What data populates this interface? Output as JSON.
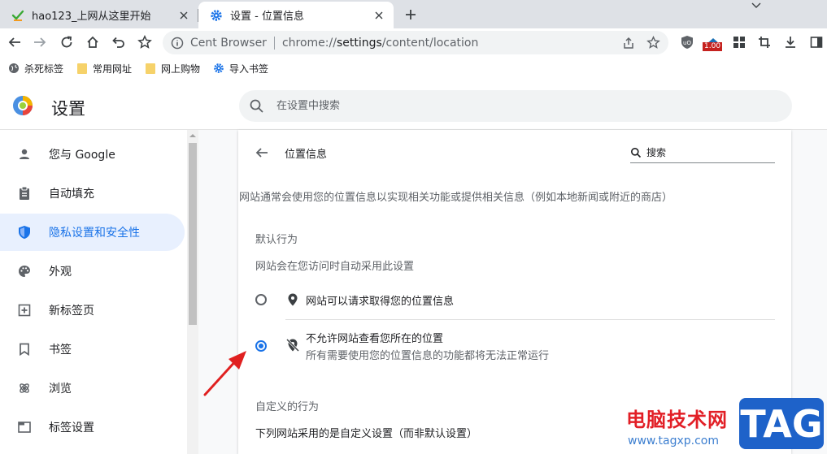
{
  "tabs": [
    {
      "title": "hao123_上网从这里开始",
      "icon": "hao123-icon",
      "active": false
    },
    {
      "title": "设置 - 位置信息",
      "icon": "settings-gear-icon",
      "active": true
    }
  ],
  "omnibox": {
    "site_name": "Cent Browser",
    "url_scheme": "chrome://",
    "url_host": "settings",
    "url_path": "/content/location"
  },
  "extension_badge": "1.00",
  "bookmarks": [
    {
      "label": "杀死标签",
      "icon": "globe-icon"
    },
    {
      "label": "常用网址",
      "icon": "folder-icon"
    },
    {
      "label": "网上购物",
      "icon": "folder-icon"
    },
    {
      "label": "导入书签",
      "icon": "gear-icon"
    }
  ],
  "settings": {
    "title": "设置",
    "search_placeholder": "在设置中搜索"
  },
  "sidebar": {
    "items": [
      {
        "label": "您与 Google",
        "icon": "person-icon",
        "active": false
      },
      {
        "label": "自动填充",
        "icon": "clipboard-icon",
        "active": false
      },
      {
        "label": "隐私设置和安全性",
        "icon": "shield-icon",
        "active": true
      },
      {
        "label": "外观",
        "icon": "palette-icon",
        "active": false
      },
      {
        "label": "新标签页",
        "icon": "new-tab-icon",
        "active": false
      },
      {
        "label": "书签",
        "icon": "bookmark-icon",
        "active": false
      },
      {
        "label": "浏览",
        "icon": "browse-icon",
        "active": false
      },
      {
        "label": "标签设置",
        "icon": "tab-settings-icon",
        "active": false
      }
    ]
  },
  "content": {
    "page_title": "位置信息",
    "search_placeholder": "搜索",
    "description": "网站通常会使用您的位置信息以实现相关功能或提供相关信息（例如本地新闻或附近的商店）",
    "default_behavior": {
      "heading": "默认行为",
      "subheading": "网站会在您访问时自动采用此设置",
      "options": [
        {
          "label": "网站可以请求取得您的位置信息",
          "sublabel": "",
          "selected": false,
          "icon": "location-pin-icon"
        },
        {
          "label": "不允许网站查看您所在的位置",
          "sublabel": "所有需要使用您的位置信息的功能都将无法正常运行",
          "selected": true,
          "icon": "location-off-icon"
        }
      ]
    },
    "custom_behavior": {
      "heading": "自定义的行为",
      "subheading": "下列网站采用的是自定义设置（而非默认设置）"
    }
  },
  "watermark": {
    "text": "电脑技术网",
    "url": "www.tagxp.com",
    "tag": "TAG"
  },
  "colors": {
    "accent": "#1a73e8",
    "active_nav_bg": "#e8f0fe",
    "arrow": "#e02020",
    "watermark_red": "#e21f26",
    "watermark_blue": "#1e62c9"
  }
}
